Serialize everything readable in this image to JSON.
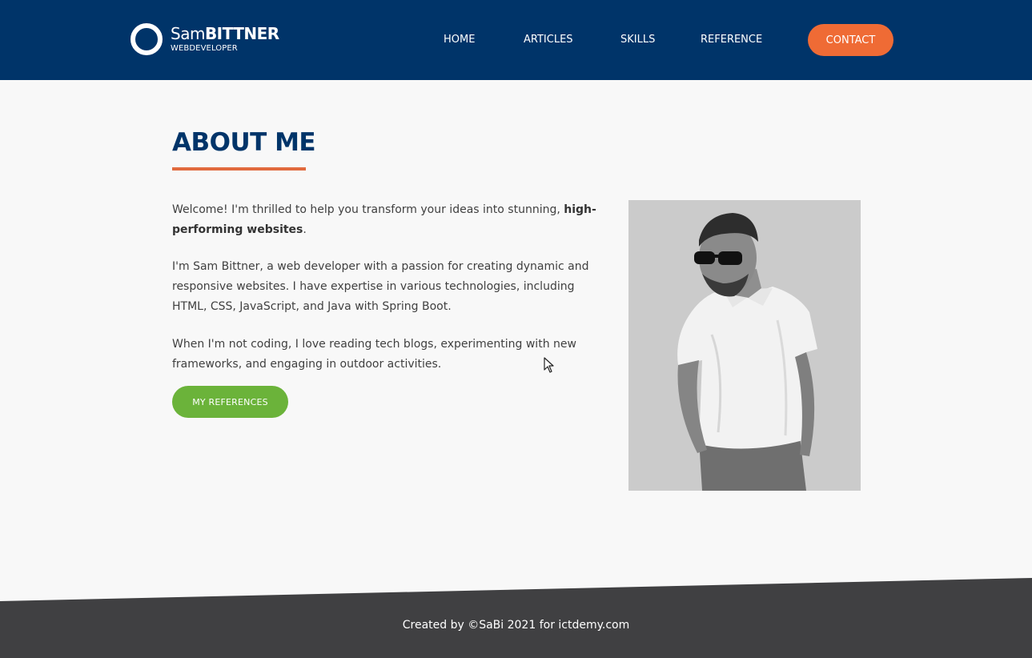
{
  "header": {
    "logo": {
      "first": "Sam",
      "last": "BITTNER",
      "subtitle": "WEBDEVELOPER"
    },
    "nav": [
      {
        "label": "HOME"
      },
      {
        "label": "ARTICLES"
      },
      {
        "label": "SKILLS"
      },
      {
        "label": "REFERENCE"
      }
    ],
    "contact_label": "CONTACT"
  },
  "about": {
    "title": "ABOUT ME",
    "intro_before": "Welcome! I'm thrilled to help you transform your ideas into stunning, ",
    "intro_bold": "high-performing websites",
    "intro_after": ".",
    "paragraph2": "I'm Sam Bittner, a web developer with a passion for creating dynamic and responsive websites. I have expertise in various technologies, including HTML, CSS, JavaScript, and Java with Spring Boot.",
    "paragraph3": "When I'm not coding, I love reading tech blogs, experimenting with new frameworks, and engaging in outdoor activities.",
    "button_label": "MY REFERENCES"
  },
  "footer": {
    "text": "Created by ©SaBi 2021 for ictdemy.com"
  },
  "colors": {
    "header_bg": "#003469",
    "accent_orange": "#ef6b35",
    "button_green": "#6bb33a",
    "footer_bg": "#404042",
    "page_bg": "#f8f8f8"
  }
}
